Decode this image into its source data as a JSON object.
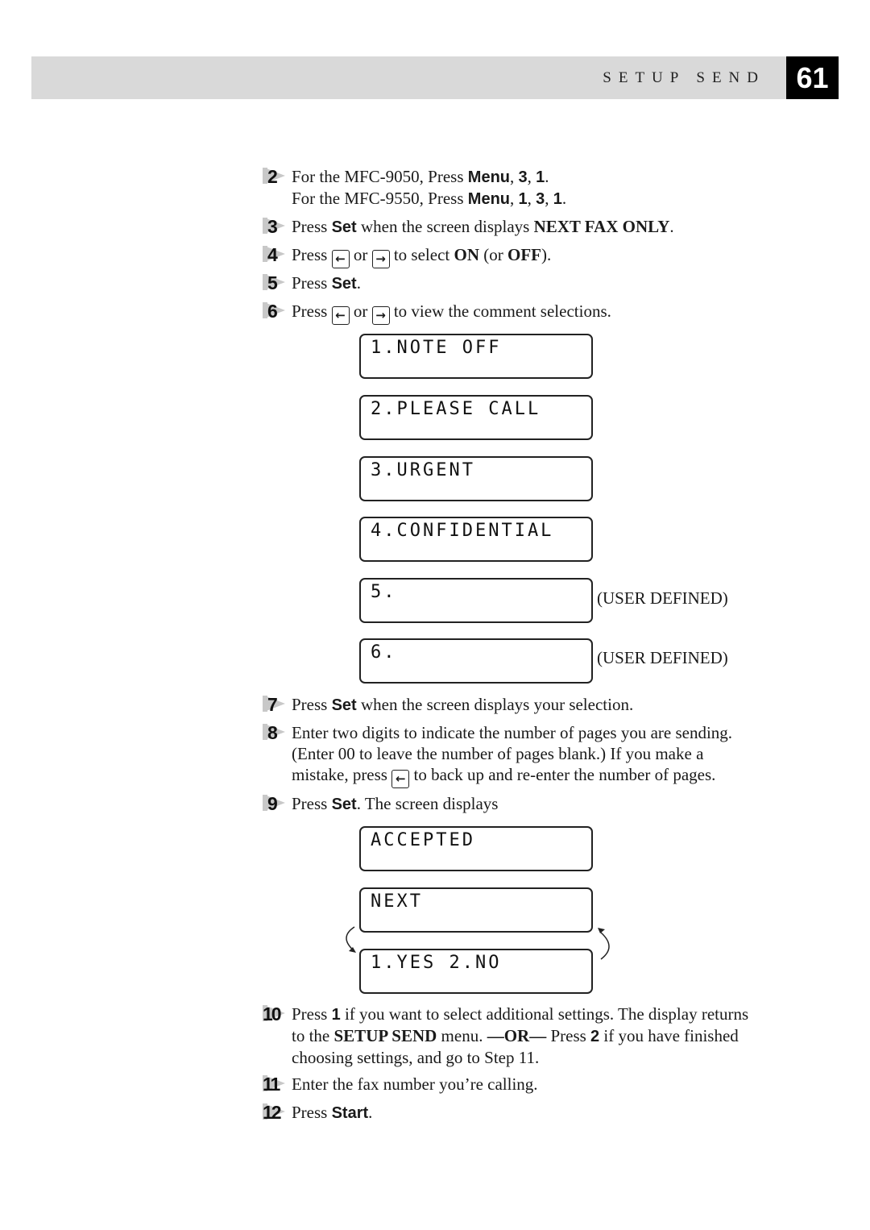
{
  "header": {
    "section_title": "SETUP SEND",
    "page_number": "61"
  },
  "steps": [
    {
      "num": "2",
      "lines": [
        [
          "For the MFC-9050, Press ",
          {
            "kb": "Menu"
          },
          ", ",
          {
            "kb": "3"
          },
          ", ",
          {
            "kb": "1"
          },
          "."
        ],
        [
          "For the MFC-9550, Press ",
          {
            "kb": "Menu"
          },
          ", ",
          {
            "kb": "1"
          },
          ", ",
          {
            "kb": "3"
          },
          ", ",
          {
            "kb": "1"
          },
          "."
        ]
      ]
    },
    {
      "num": "3",
      "lines": [
        [
          "Press ",
          {
            "kb": "Set"
          },
          " when the screen displays ",
          {
            "b": "NEXT FAX ONLY"
          },
          "."
        ]
      ]
    },
    {
      "num": "4",
      "lines": [
        [
          "Press ",
          {
            "key": "left-arrow"
          },
          " or ",
          {
            "key": "right-arrow"
          },
          " to select ",
          {
            "b": "ON"
          },
          " (or ",
          {
            "b": "OFF"
          },
          ")."
        ]
      ]
    },
    {
      "num": "5",
      "lines": [
        [
          "Press ",
          {
            "kb": "Set"
          },
          "."
        ]
      ]
    },
    {
      "num": "6",
      "lines": [
        [
          "Press ",
          {
            "key": "left-arrow"
          },
          " or ",
          {
            "key": "right-arrow"
          },
          " to view the comment selections."
        ]
      ]
    },
    {
      "num": "7",
      "lines": [
        [
          "Press ",
          {
            "kb": "Set"
          },
          " when the screen displays your selection."
        ]
      ]
    },
    {
      "num": "8",
      "lines": [
        [
          "Enter two digits to indicate the number of pages you are sending."
        ],
        [
          "(Enter 00 to leave the number of pages blank.) If you make a"
        ],
        [
          "mistake, press ",
          {
            "key": "left-arrow"
          },
          " to back up and re-enter the number of pages."
        ]
      ]
    },
    {
      "num": "9",
      "lines": [
        [
          "Press ",
          {
            "kb": "Set"
          },
          ". The screen displays"
        ]
      ]
    },
    {
      "num": "10",
      "lines": [
        [
          "Press ",
          {
            "kb": "1"
          },
          " if you want to select additional settings. The display returns"
        ],
        [
          "to the ",
          {
            "b": "SETUP SEND"
          },
          " menu. ",
          {
            "b": "—OR—"
          },
          " Press ",
          {
            "kb": "2"
          },
          " if you have finished"
        ],
        [
          "choosing settings, and go to Step 11."
        ]
      ]
    },
    {
      "num": "11",
      "lines": [
        [
          "Enter the fax number you’re calling."
        ]
      ]
    },
    {
      "num": "12",
      "lines": [
        [
          "Press ",
          {
            "kb": "Start"
          },
          "."
        ]
      ]
    }
  ],
  "icons": {
    "left-arrow": "←",
    "right-arrow": "→"
  },
  "lcd_comments": [
    {
      "text": "1.NOTE OFF",
      "note": ""
    },
    {
      "text": "2.PLEASE CALL",
      "note": ""
    },
    {
      "text": "3.URGENT",
      "note": ""
    },
    {
      "text": "4.CONFIDENTIAL",
      "note": ""
    },
    {
      "text": "5.",
      "note": "(USER DEFINED)"
    },
    {
      "text": "6.",
      "note": "(USER DEFINED)"
    }
  ],
  "lcd_result": [
    {
      "text": "ACCEPTED"
    },
    {
      "text": "NEXT"
    },
    {
      "text": "1.YES 2.NO"
    }
  ]
}
